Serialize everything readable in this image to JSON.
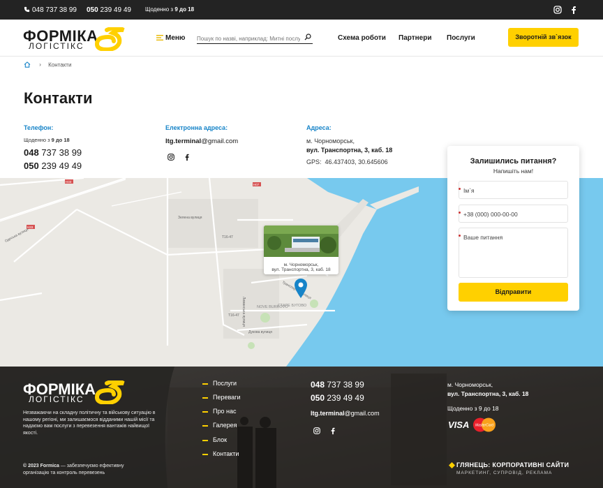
{
  "topbar": {
    "phone1_prefix": "048",
    "phone1_number": "737 38 99",
    "phone2_prefix": "050",
    "phone2_number": "239 49 49",
    "hours_prefix": "Щоденно з",
    "hours_value": "9 до 18",
    "instagram_icon": "instagram-icon",
    "facebook_icon": "facebook-icon"
  },
  "header": {
    "logo_line1": "ФОРМІКА",
    "logo_line2": "ЛОГІСТІКС",
    "menu_label": "Меню",
    "search_placeholder": "Пошук по назві, наприклад: Митні послуги",
    "nav": [
      "Схема роботи",
      "Партнери",
      "Послуги"
    ],
    "cta_label": "Зворотній зв`язок",
    "accent": "#ffd000"
  },
  "breadcrumb": {
    "home_icon": "home-icon",
    "current": "Контакти"
  },
  "page": {
    "title": "Контакти",
    "phone_label": "Телефон:",
    "phone_hours_prefix": "Щоденно з",
    "phone_hours_value": "9 до 18",
    "phone1_prefix": "048",
    "phone1_number": "737 38 99",
    "phone2_prefix": "050",
    "phone2_number": "239 49 49",
    "email_label": "Електронна адреса:",
    "email_user": "ltg.terminal",
    "email_domain": "@gmail.com",
    "address_label": "Адреса:",
    "address_city": "м. Чорноморськ,",
    "address_street": "вул. Транспортна, 3, каб. 18",
    "gps_label": "GPS:",
    "gps_value": "46.437403, 30.645606",
    "label_color": "#1784c8"
  },
  "map": {
    "popup_city": "м. Чорноморськ,",
    "popup_street": "вул. Транспортна, 3, каб. 18",
    "labels": [
      "Зелена вулиця",
      "Одеська вулиця",
      "Т16-47",
      "Т16-47",
      "Н33",
      "Н33",
      "Н07",
      "NOVE BURKOVO",
      "СТАРЕ БУГОВО",
      "Дукова вулиця",
      "Транспортна вулиця",
      "Лиманська вулиця"
    ],
    "sea_color": "#77c9ee"
  },
  "form": {
    "title": "Залишились питання?",
    "subtitle": "Напишіть нам!",
    "name_placeholder": "Ім`я",
    "phone_placeholder": "+38 (000) 000-00-00",
    "question_placeholder": "Ваше питання",
    "submit_label": "Відправити"
  },
  "footer": {
    "logo_line1": "ФОРМІКА",
    "logo_line2": "ЛОГІСТІКС",
    "about": "Незважаючи на складну політичну та військову ситуацію в нашому регіоні, ми залишаємося відданими нашій місії та надаємо вам послуги з перевезення вантажів найвищої якості.",
    "copyright_year": "© 2023 Formica",
    "copyright_text": "— забезпечуємо ефективну організацію та контроль перевезень",
    "menu": [
      "Послуги",
      "Переваги",
      "Про нас",
      "Галерея",
      "Блок",
      "Контакти"
    ],
    "phone1_prefix": "048",
    "phone1_number": "737 38 99",
    "phone2_prefix": "050",
    "phone2_number": "239 49 49",
    "email_user": "ltg.terminal",
    "email_domain": "@gmail.com",
    "address_city": "м. Чорноморськ,",
    "address_street": "вул. Транспортна, 3, каб. 18",
    "hours": "Щоденно з 9 до 18",
    "visa_label": "VISA",
    "mastercard_label": "MasterCard",
    "studio_name": "ГЛЯНЕЦЬ: КОРПОРАТИВНІ САЙТИ",
    "studio_tagline": "МАРКЕТИНГ, СУПРОВІД, РЕКЛАМА"
  }
}
